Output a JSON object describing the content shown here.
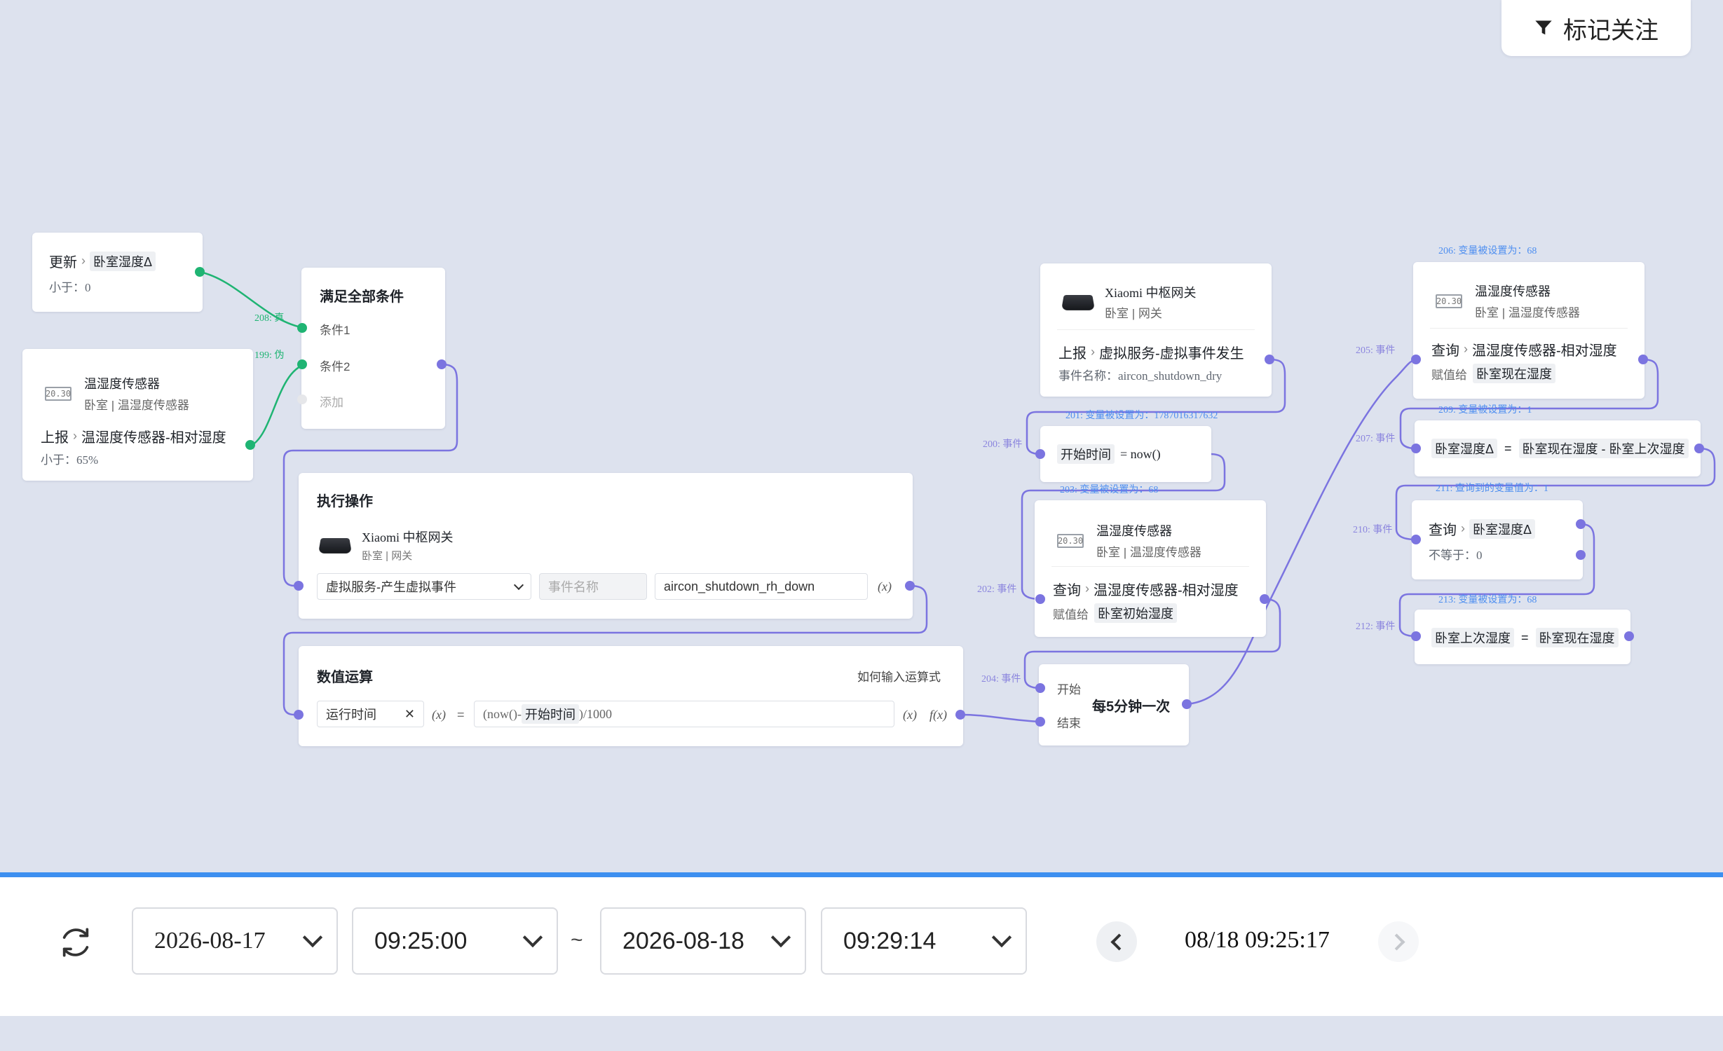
{
  "toolbar": {
    "filter_label": "标记关注"
  },
  "colors": {
    "wire_purple": "#7b74e0",
    "wire_green": "#1fb473",
    "label_blue": "#4d8ef0",
    "progress": "#3d8ff0"
  },
  "nodes": {
    "update": {
      "title": "更新",
      "var": "卧室湿度Δ",
      "cond": "小于：0"
    },
    "sensor1": {
      "name": "温湿度传感器",
      "loc": "卧室 | 温湿度传感器",
      "action": "上报",
      "prop": "温湿度传感器-相对湿度",
      "cond": "小于：65%"
    },
    "all_cond": {
      "title": "满足全部条件",
      "c1": "条件1",
      "c2": "条件2",
      "add": "添加"
    },
    "exec": {
      "title": "执行操作",
      "device": "Xiaomi 中枢网关",
      "loc": "卧室 | 网关",
      "service": "虚拟服务-产生虚拟事件",
      "event_placeholder": "事件名称",
      "event_value": "aircon_shutdown_rh_down",
      "fx": "(x)"
    },
    "calc": {
      "title": "数值运算",
      "help": "如何输入运算式",
      "var": "运行时间",
      "x1": "(x)",
      "eq": "=",
      "expr_pre": "(now()-",
      "expr_tag": "开始时间",
      "expr_post": ")/1000",
      "x2": "(x)",
      "f": "f(x)"
    },
    "gateway": {
      "name": "Xiaomi 中枢网关",
      "loc": "卧室 | 网关",
      "action": "上报",
      "prop": "虚拟服务-虚拟事件发生",
      "sub": "事件名称：aircon_shutdown_dry"
    },
    "start_time": {
      "tag": "开始时间",
      "expr": "= now()"
    },
    "sensor2": {
      "name": "温湿度传感器",
      "loc": "卧室 | 温湿度传感器",
      "action": "查询",
      "prop": "温湿度传感器-相对湿度",
      "assign": "赋值给",
      "target": "卧室初始湿度"
    },
    "timer": {
      "start": "开始",
      "end": "结束",
      "label": "每5分钟一次"
    },
    "sensor3": {
      "name": "温湿度传感器",
      "loc": "卧室 | 温湿度传感器",
      "action": "查询",
      "prop": "温湿度传感器-相对湿度",
      "assign": "赋值给",
      "target": "卧室现在湿度"
    },
    "delta": {
      "lhs": "卧室湿度Δ",
      "eq": "=",
      "rhs": "卧室现在湿度 - 卧室上次湿度"
    },
    "query_delta": {
      "action": "查询",
      "var": "卧室湿度Δ",
      "cond": "不等于：0"
    },
    "last": {
      "lhs": "卧室上次湿度",
      "eq": "=",
      "rhs": "卧室现在湿度"
    }
  },
  "edge_labels": {
    "e208": "208: 真",
    "e199": "199: 伪",
    "e201": "201: 变量被设置为：1787016317632",
    "e200": "200: 事件",
    "e203": "203: 变量被设置为：68",
    "e202": "202: 事件",
    "e204": "204: 事件",
    "e206": "206: 变量被设置为：68",
    "e205": "205: 事件",
    "e209": "209: 变量被设置为：1",
    "e207": "207: 事件",
    "e211": "211: 查询到的变量值为：1",
    "e210": "210: 事件",
    "e213": "213: 变量被设置为：68",
    "e212": "212: 事件"
  },
  "timebar": {
    "start_date": "2026-08-17",
    "start_time": "09:25:00",
    "sep": "~",
    "end_date": "2026-08-18",
    "end_time": "09:29:14",
    "current": "08/18 09:25:17"
  }
}
